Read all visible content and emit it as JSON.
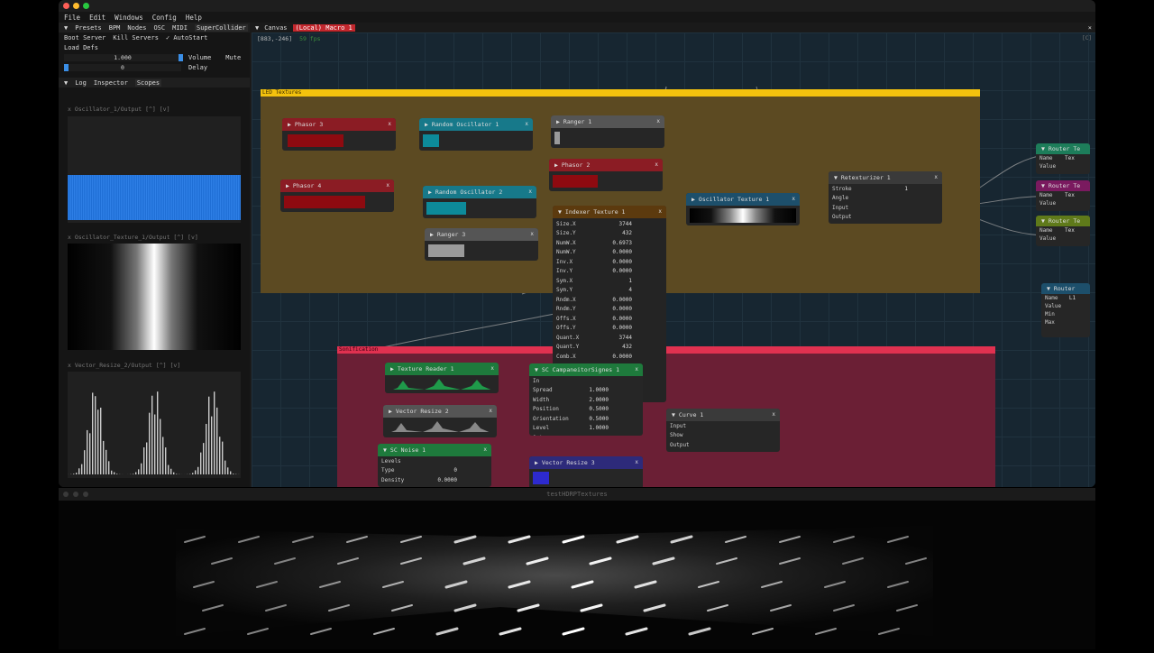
{
  "menu": [
    "File",
    "Edit",
    "Windows",
    "Config",
    "Help"
  ],
  "left_tabs": [
    "Presets",
    "BPM",
    "Nodes",
    "OSC",
    "MIDI",
    "SuperCollider"
  ],
  "server": {
    "boot": "Boot Server",
    "kill": "Kill Servers",
    "autostart": "AutoStart",
    "load_defs": "Load Defs"
  },
  "volume": {
    "value": "1.000",
    "label": "Volume",
    "mute": "Mute"
  },
  "delay": {
    "value": "0",
    "label": "Delay"
  },
  "log_tabs": [
    "Log",
    "Inspector",
    "Scopes"
  ],
  "scopes": [
    {
      "title": "x  Oscillator_1/Output  [^]  [v]"
    },
    {
      "title": "x  Oscillator_Texture_1/Output  [^]  [v]"
    },
    {
      "title": "x  Vector_Resize_2/Output  [^]  [v]"
    }
  ],
  "canvas_tabs": {
    "canvas": "Canvas",
    "macro": "(Local) Macro 1",
    "close": "×"
  },
  "canvas_info": {
    "coords": "[883,-246]",
    "fps": "59 fps",
    "corner": "[C]"
  },
  "groups": {
    "led": "LED Textures",
    "son": "Sonification"
  },
  "nodes": {
    "phasor3": "Phasor 3",
    "phasor4": "Phasor 4",
    "phasor2": "Phasor 2",
    "rosc1": "Random Oscillator 1",
    "rosc2": "Random Oscillator 2",
    "ranger1": "Ranger 1",
    "ranger3": "Ranger 3",
    "indexer": "Indexer Texture 1",
    "osctex": "Oscillator Texture 1",
    "retex": "Retexturizer 1",
    "texreader": "Texture Reader 1",
    "vresize2": "Vector Resize 2",
    "vresize3": "Vector Resize 3",
    "scnoise": "SC Noise 1",
    "campan": "SC CampaneitorSignes 1",
    "curve": "Curve 1",
    "router1": "Router Te",
    "router2": "Router Te",
    "router3": "Router Te",
    "router4": "Router"
  },
  "retex_params": [
    {
      "k": "Stroke",
      "v": "1"
    },
    {
      "k": "Angle",
      "v": ""
    },
    {
      "k": "Input",
      "v": ""
    },
    {
      "k": "Output",
      "v": ""
    }
  ],
  "indexer_params": [
    {
      "k": "Size.X",
      "v": "3744"
    },
    {
      "k": "Size.Y",
      "v": "432"
    },
    {
      "k": "NumW.X",
      "v": "0.6973"
    },
    {
      "k": "NumW.Y",
      "v": "0.0000"
    },
    {
      "k": "Inv.X",
      "v": "0.0000"
    },
    {
      "k": "Inv.Y",
      "v": "0.0000"
    },
    {
      "k": "Sym.X",
      "v": "1"
    },
    {
      "k": "Sym.Y",
      "v": "4"
    },
    {
      "k": "Rndm.X",
      "v": "0.0000"
    },
    {
      "k": "Rndm.Y",
      "v": "0.0000"
    },
    {
      "k": "Offs.X",
      "v": "0.0000"
    },
    {
      "k": "Offs.Y",
      "v": "0.0000"
    },
    {
      "k": "Quant.X",
      "v": "3744"
    },
    {
      "k": "Quant.Y",
      "v": "432"
    },
    {
      "k": "Comb.X",
      "v": "0.0000"
    }
  ],
  "campan_params": [
    {
      "k": "In",
      "v": ""
    },
    {
      "k": "Spread",
      "v": "1.0000"
    },
    {
      "k": "Width",
      "v": "2.0000"
    },
    {
      "k": "Position",
      "v": "0.5000"
    },
    {
      "k": "Orientation",
      "v": "0.5000"
    },
    {
      "k": "Level",
      "v": "1.0000"
    },
    {
      "k": "Out",
      "v": ""
    }
  ],
  "curve_params": [
    {
      "k": "Input",
      "v": ""
    },
    {
      "k": "Show",
      "v": ""
    },
    {
      "k": "Output",
      "v": ""
    }
  ],
  "scnoise_params": [
    {
      "k": "Levels",
      "v": ""
    },
    {
      "k": "Type",
      "v": "0"
    },
    {
      "k": "Density",
      "v": "0.0000"
    }
  ],
  "router_params": [
    {
      "k": "Name",
      "v": "Tex"
    },
    {
      "k": "Value",
      "v": ""
    }
  ],
  "router4_params": [
    {
      "k": "Name",
      "v": "L1"
    },
    {
      "k": "Value",
      "v": ""
    },
    {
      "k": "Min",
      "v": ""
    },
    {
      "k": "Max",
      "v": ""
    }
  ],
  "bottom_title": "testHDRPTextures",
  "colors": {
    "led": "#f4c20d",
    "son": "#e03150",
    "phasor": "#8b1c24",
    "rosc": "#17798a",
    "ranger": "#555555",
    "indexer": "#5c3a0e",
    "osctex": "#1d4f6b",
    "retex": "#3a3a3a",
    "texreader": "#1e7a3c",
    "campan": "#1e7a3c",
    "vresize3": "#2d2a7a",
    "curve": "#3a3a3a",
    "router_green": "#1d7d5a",
    "router_purple": "#7a1a5f",
    "router_olive": "#5f7a1a",
    "router_blue": "#1d4f6b"
  }
}
